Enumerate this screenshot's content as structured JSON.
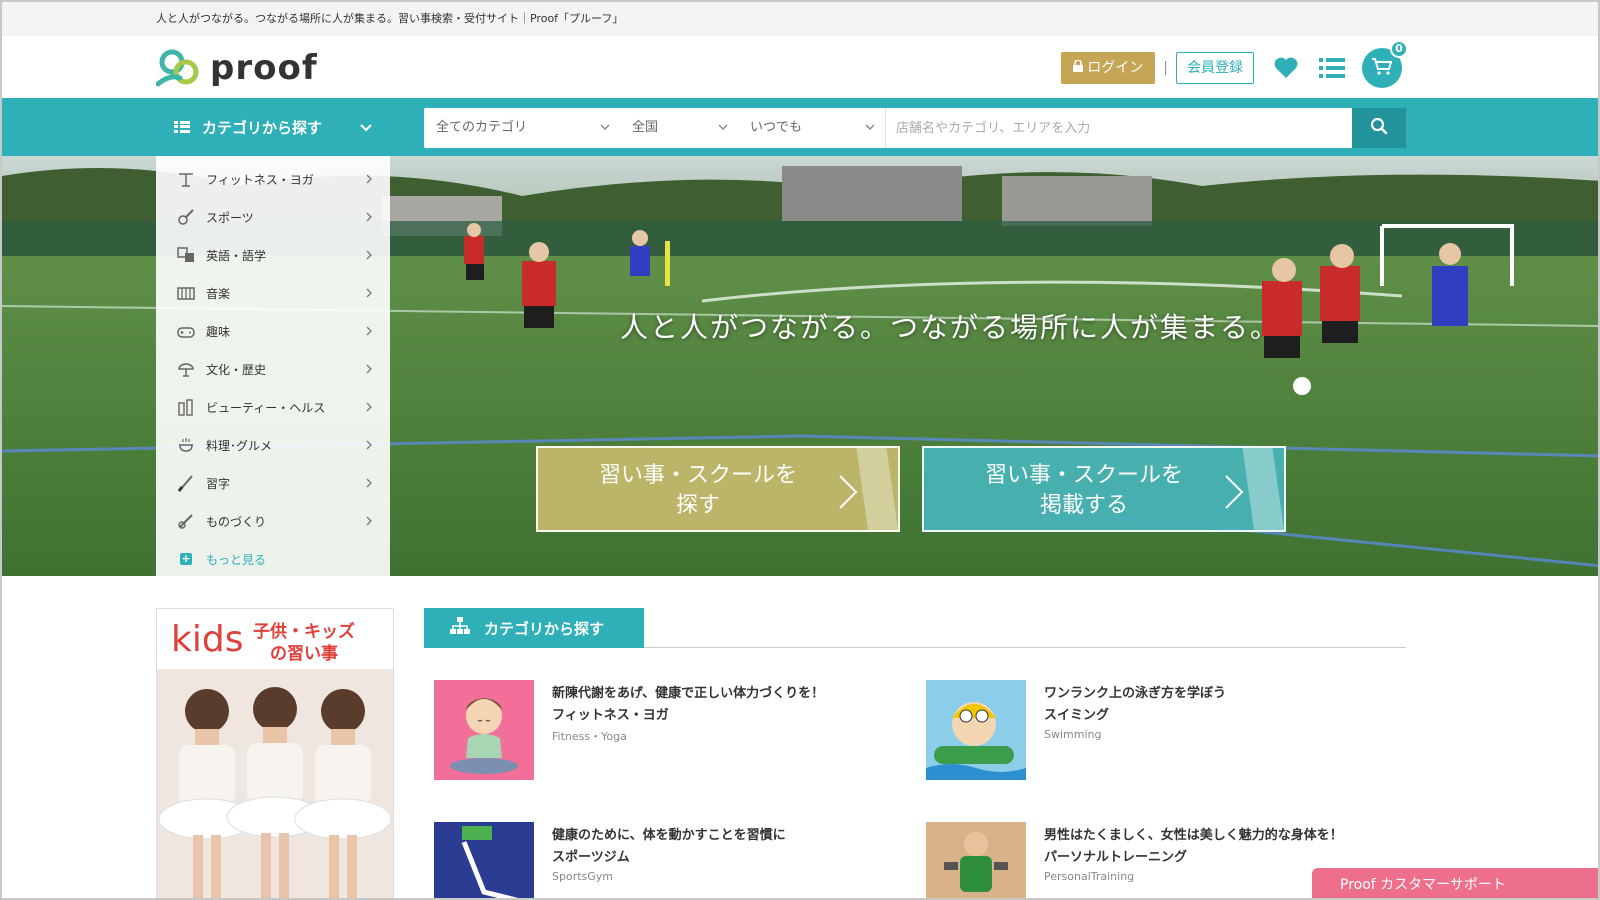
{
  "site": {
    "tagline": "人と人がつながる。つながる場所に人が集まる。習い事検索・受付サイト｜Proof「プルーフ」",
    "logo_text": "proof"
  },
  "header": {
    "login_label": "ログイン",
    "separator": "|",
    "register_label": "会員登録",
    "cart_count": "0",
    "icons": [
      "heart-icon",
      "list-icon",
      "cart-icon"
    ]
  },
  "nav": {
    "category_toggle_label": "カテゴリから探す",
    "search": {
      "category_select": "全てのカテゴリ",
      "area_select": "全国",
      "time_select": "いつでも",
      "keyword_placeholder": "店舗名やカテゴリ、エリアを入力"
    }
  },
  "category_menu": {
    "items": [
      {
        "label": "フィットネス・ヨガ",
        "icon": "fitness-icon"
      },
      {
        "label": "スポーツ",
        "icon": "sports-icon"
      },
      {
        "label": "英語・語学",
        "icon": "language-icon"
      },
      {
        "label": "音楽",
        "icon": "music-icon"
      },
      {
        "label": "趣味",
        "icon": "hobby-icon"
      },
      {
        "label": "文化・歴史",
        "icon": "culture-icon"
      },
      {
        "label": "ビューティー・ヘルス",
        "icon": "beauty-icon"
      },
      {
        "label": "料理･グルメ",
        "icon": "cooking-icon"
      },
      {
        "label": "習字",
        "icon": "calligraphy-icon"
      },
      {
        "label": "ものづくり",
        "icon": "crafts-icon"
      }
    ],
    "more_label": "もっと見る"
  },
  "hero": {
    "title": "人と人がつながる。つながる場所に人が集まる。",
    "cta_find_line1": "習い事・スクールを",
    "cta_find_line2": "探す",
    "cta_post_line1": "習い事・スクールを",
    "cta_post_line2": "掲載する"
  },
  "kids_banner": {
    "word": "kids",
    "sub_line1": "子供・キッズ",
    "sub_line2": "の習い事"
  },
  "section": {
    "title": "カテゴリから探す",
    "cards": [
      {
        "lead": "新陳代謝をあげ、健康で正しい体力づくりを！",
        "name": "フィットネス・ヨガ",
        "en": "Fitness・Yoga"
      },
      {
        "lead": "ワンランク上の泳ぎ方を学ぼう",
        "name": "スイミング",
        "en": "Swimming"
      },
      {
        "lead": "健康のために、体を動かすことを習慣に",
        "name": "スポーツジム",
        "en": "SportsGym"
      },
      {
        "lead": "男性はたくましく、女性は美しく魅力的な身体を！",
        "name": "パーソナルトレーニング",
        "en": "PersonalTraining"
      }
    ]
  },
  "support": {
    "label": "Proof カスタマーサポート"
  },
  "colors": {
    "teal": "#2fb0b8",
    "gold": "#c6a555",
    "pink": "#ee6f8c"
  }
}
